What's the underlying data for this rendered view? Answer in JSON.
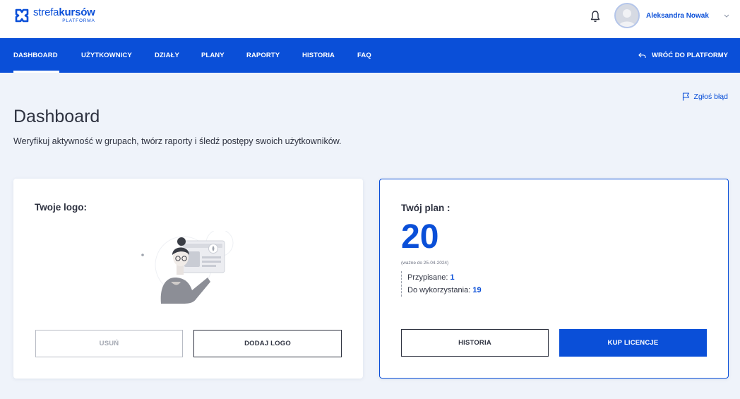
{
  "header": {
    "logo_light": "strefa",
    "logo_bold": "kursów",
    "logo_sub": "PLATFORMA",
    "user_name": "Aleksandra Nowak",
    "icons": {
      "notifications": "bell-icon",
      "user_menu": "chevron-down-icon"
    }
  },
  "nav": {
    "items": [
      {
        "label": "DASHBOARD",
        "active": true
      },
      {
        "label": "UŻYTKOWNICY",
        "active": false
      },
      {
        "label": "DZIAŁY",
        "active": false
      },
      {
        "label": "PLANY",
        "active": false
      },
      {
        "label": "RAPORTY",
        "active": false
      },
      {
        "label": "HISTORIA",
        "active": false
      },
      {
        "label": "FAQ",
        "active": false
      }
    ],
    "back_label": "WRÓĆ DO PLATFORMY"
  },
  "report_label": "Zgłoś błąd",
  "page": {
    "title": "Dashboard",
    "subtitle": "Weryfikuj aktywność w grupach, twórz raporty i śledź postępy swoich użytkowników."
  },
  "logo_card": {
    "title": "Twoje logo:",
    "remove_label": "USUŃ",
    "add_label": "DODAJ LOGO"
  },
  "plan_card": {
    "title": "Twój plan :",
    "count": "20",
    "valid_until": "(ważne do 25-04-2024)",
    "assigned_label": "Przypisane:",
    "assigned_value": "1",
    "available_label": "Do wykorzystania:",
    "available_value": "19",
    "history_label": "HISTORIA",
    "buy_label": "KUP LICENCJE"
  },
  "colors": {
    "brand": "#0a4fd8",
    "background": "#eff3fa",
    "text": "#2e3240"
  }
}
